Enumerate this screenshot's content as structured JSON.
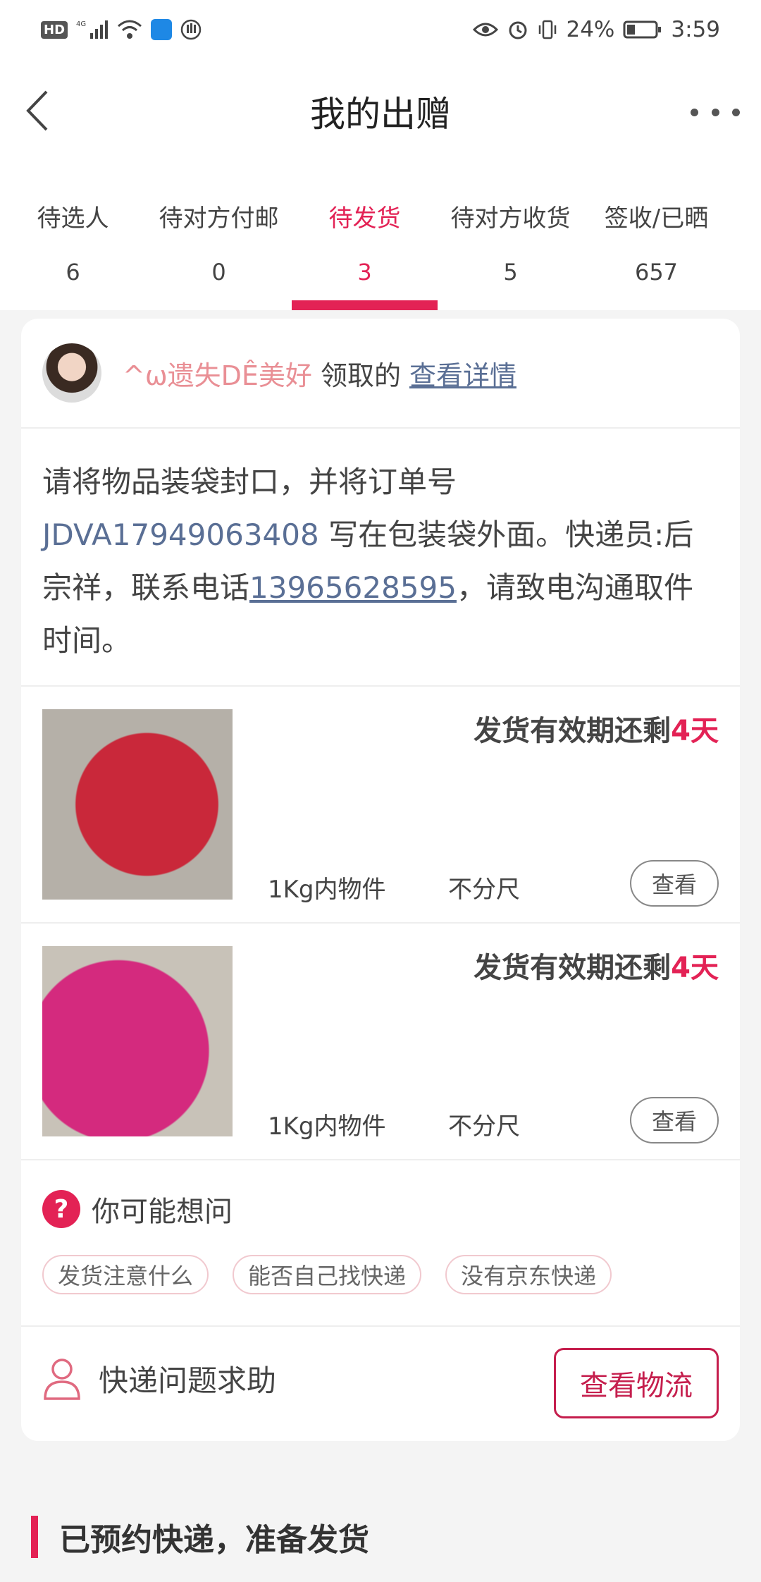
{
  "status_bar": {
    "network": "4G",
    "battery": "24%",
    "time": "3:59",
    "icons": [
      "hd-icon",
      "signal-icon",
      "wifi-icon",
      "search-app-icon",
      "hand-icon",
      "eye-icon",
      "alarm-icon",
      "vibrate-icon",
      "battery-icon"
    ]
  },
  "header": {
    "title": "我的出赠"
  },
  "tabs": [
    {
      "label": "待选人",
      "count": "6"
    },
    {
      "label": "待对方付邮",
      "count": "0"
    },
    {
      "label": "待发货",
      "count": "3",
      "active": true
    },
    {
      "label": "待对方收货",
      "count": "5"
    },
    {
      "label": "签收/已晒",
      "count": "657"
    }
  ],
  "recipient": {
    "nickname": "^ω遗失DÊ美好",
    "received_text": "领取的",
    "detail_link": "查看详情"
  },
  "instructions": {
    "part1": "请将物品装袋封口，并将订单号 ",
    "order_no": "JDVA17949063408",
    "part2": " 写在包装袋外面。快递员:后宗祥，联系电话",
    "phone": "13965628595",
    "part3": "，请致电沟通取件时间。"
  },
  "items": [
    {
      "deadline_prefix": "发货有效期还剩",
      "deadline_days": "4天",
      "weight": "1Kg内物件",
      "size": "不分尺",
      "view_label": "查看"
    },
    {
      "deadline_prefix": "发货有效期还剩",
      "deadline_days": "4天",
      "weight": "1Kg内物件",
      "size": "不分尺",
      "view_label": "查看"
    }
  ],
  "faq": {
    "title": "你可能想问",
    "chips": [
      "发货注意什么",
      "能否自己找快递",
      "没有京东快递"
    ]
  },
  "help": {
    "label": "快递问题求助",
    "track_button": "查看物流"
  },
  "bottom": {
    "title": "已预约快递，准备发货"
  },
  "colors": {
    "accent": "#e32255",
    "link": "#5a6f95",
    "nickname": "#e98f95"
  }
}
